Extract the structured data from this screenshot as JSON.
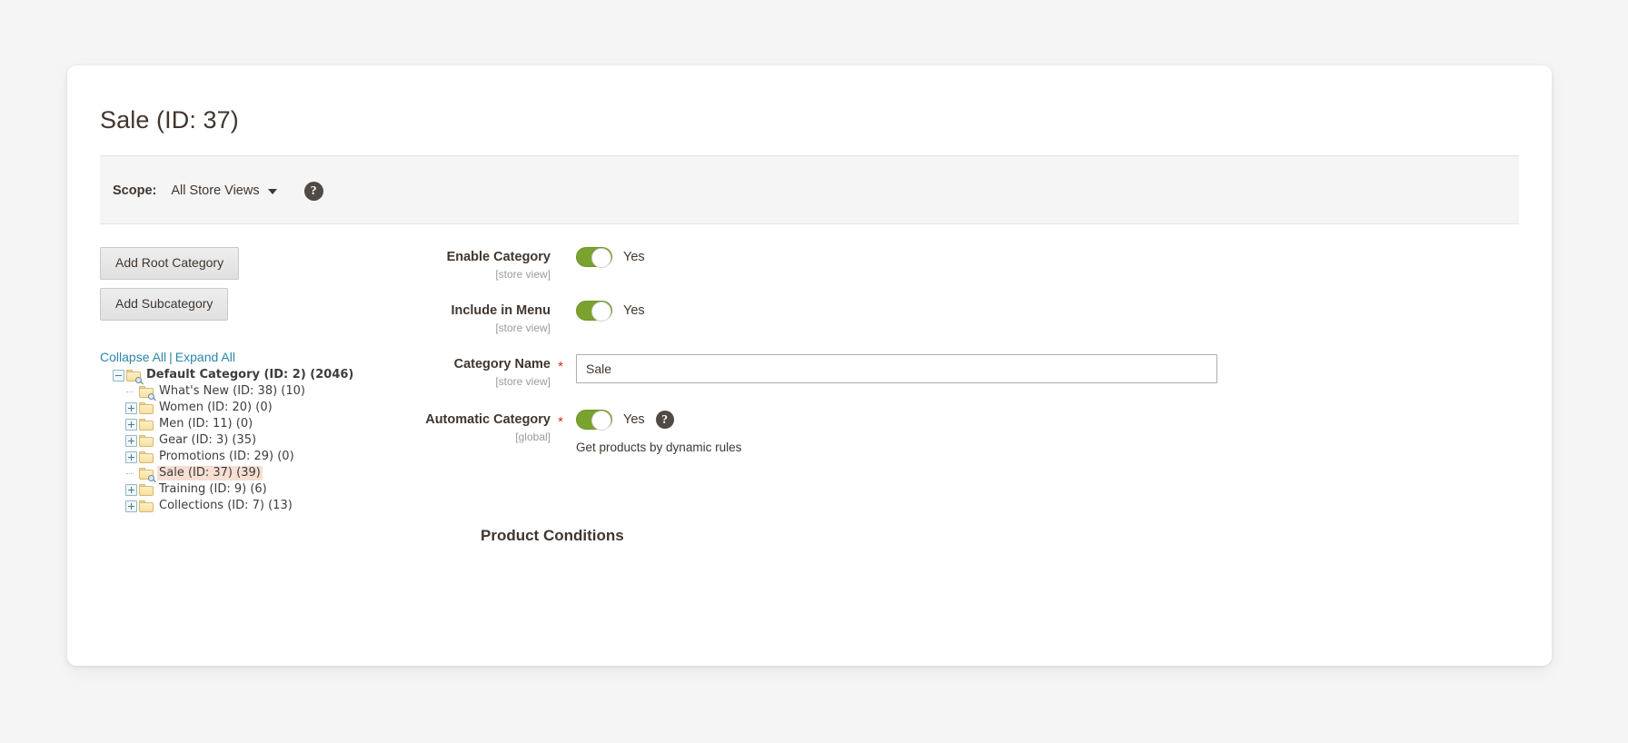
{
  "page": {
    "title": "Sale (ID: 37)"
  },
  "scope": {
    "label": "Scope:",
    "value": "All Store Views",
    "help_icon": "help-question-icon",
    "caret_icon": "chevron-down-icon"
  },
  "buttons": {
    "add_root_category": "Add Root Category",
    "add_subcategory": "Add Subcategory"
  },
  "tree_actions": {
    "collapse_all": "Collapse All",
    "separator": "|",
    "expand_all": "Expand All"
  },
  "tree": {
    "nodes": [
      {
        "label": "Default Category (ID: 2) (2046)",
        "depth": 0,
        "expander": "minus",
        "icon": "folder-search-icon",
        "bold": true,
        "selected": false
      },
      {
        "label": "What's New (ID: 38) (10)",
        "depth": 1,
        "expander": "none",
        "icon": "folder-search-icon",
        "bold": false,
        "selected": false
      },
      {
        "label": "Women (ID: 20) (0)",
        "depth": 1,
        "expander": "plus",
        "icon": "folder-icon",
        "bold": false,
        "selected": false
      },
      {
        "label": "Men (ID: 11) (0)",
        "depth": 1,
        "expander": "plus",
        "icon": "folder-icon",
        "bold": false,
        "selected": false
      },
      {
        "label": "Gear (ID: 3) (35)",
        "depth": 1,
        "expander": "plus",
        "icon": "folder-icon",
        "bold": false,
        "selected": false
      },
      {
        "label": "Promotions (ID: 29) (0)",
        "depth": 1,
        "expander": "plus",
        "icon": "folder-icon",
        "bold": false,
        "selected": false
      },
      {
        "label": "Sale (ID: 37) (39)",
        "depth": 1,
        "expander": "none",
        "icon": "folder-search-icon",
        "bold": false,
        "selected": true
      },
      {
        "label": "Training (ID: 9) (6)",
        "depth": 1,
        "expander": "plus",
        "icon": "folder-icon",
        "bold": false,
        "selected": false
      },
      {
        "label": "Collections (ID: 7) (13)",
        "depth": 1,
        "expander": "plus",
        "icon": "folder-icon",
        "bold": false,
        "selected": false
      }
    ]
  },
  "form": {
    "enable_category": {
      "label": "Enable Category",
      "scope": "[store view]",
      "toggle_state": "Yes"
    },
    "include_in_menu": {
      "label": "Include in Menu",
      "scope": "[store view]",
      "toggle_state": "Yes"
    },
    "category_name": {
      "label": "Category Name",
      "scope": "[store view]",
      "required_marker": "*",
      "value": "Sale",
      "placeholder": ""
    },
    "automatic_category": {
      "label": "Automatic Category",
      "scope": "[global]",
      "required_marker": "*",
      "toggle_state": "Yes",
      "help_icon": "help-question-icon",
      "hint": "Get products by dynamic rules"
    }
  },
  "section": {
    "product_conditions": "Product Conditions"
  },
  "colors": {
    "toggle_on": "#79a22e",
    "link": "#2b87a8",
    "required_star": "#e22626",
    "selected_row": "#f7dfd3",
    "text": "#41362f",
    "page_bg": "#f5f5f5"
  }
}
